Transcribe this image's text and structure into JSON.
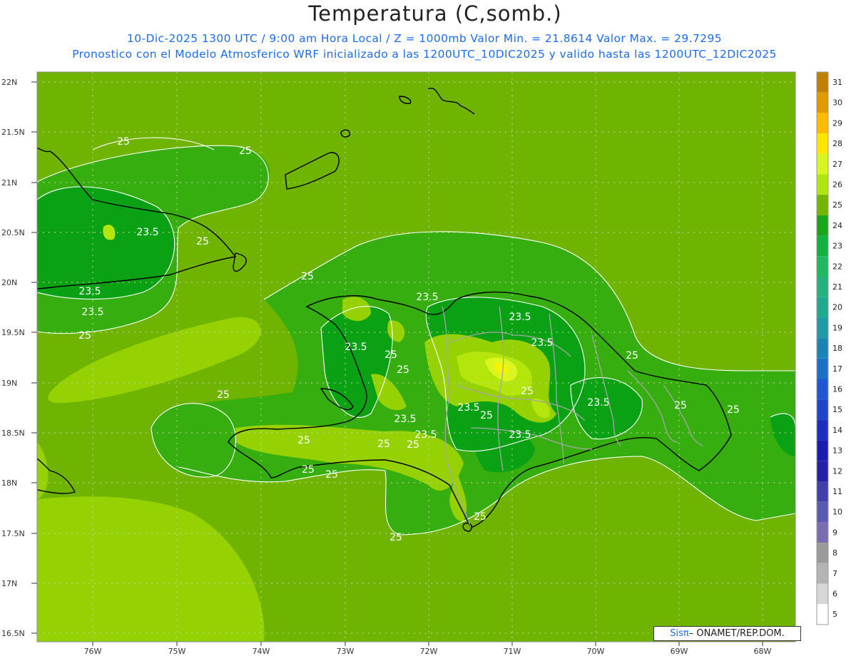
{
  "header": {
    "title": "Temperatura (C,somb.)",
    "subtitle_line1": "10-Dic-2025  1300 UTC / 9:00 am Hora Local / Z = 1000mb   Valor Min. = 21.8614  Valor Max. = 29.7295",
    "subtitle_line2": "Pronostico con el Modelo Atmosferico WRF inicializado a las 1200UTC_10DIC2025 y valido hasta las  1200UTC_12DIC2025"
  },
  "map": {
    "lat_labels": [
      "22N",
      "21.5N",
      "21N",
      "20.5N",
      "20N",
      "19.5N",
      "19N",
      "18.5N",
      "18N",
      "17.5N",
      "17N",
      "16.5N"
    ],
    "lon_labels": [
      "76W",
      "75W",
      "74W",
      "73W",
      "72W",
      "71W",
      "70W",
      "69W",
      "68W"
    ],
    "contour_labels": [
      "25",
      "25",
      "23.5",
      "25",
      "23.5",
      "23.5",
      "25",
      "25",
      "23.5",
      "23.5",
      "25",
      "25",
      "23.5",
      "25",
      "23.5",
      "25",
      "23.5",
      "25",
      "23.5",
      "25",
      "23.5",
      "25",
      "25",
      "25",
      "25",
      "25",
      "23.5",
      "23.5",
      "25",
      "25",
      "25",
      "25"
    ],
    "colors": {
      "t23": "#0aa214",
      "t24": "#37ae0f",
      "t25": "#6fb400",
      "t26": "#95d103",
      "t27": "#b4e60c",
      "t28": "#dcf51e",
      "t29": "#f5f500",
      "coast": "#000000",
      "borders": "#a6a6a6",
      "contour_line": "#ffffff"
    }
  },
  "colorbar": {
    "labels": [
      "31",
      "30",
      "29",
      "28",
      "27",
      "26",
      "25",
      "24",
      "23",
      "22",
      "21",
      "20",
      "19",
      "18",
      "17",
      "16",
      "15",
      "14",
      "13",
      "12",
      "11",
      "10",
      "9",
      "8",
      "7",
      "6",
      "5"
    ],
    "colors": [
      "#c08000",
      "#e09b00",
      "#ffbb00",
      "#ffe600",
      "#d7f51e",
      "#aee614",
      "#74b500",
      "#1ba51a",
      "#11b23e",
      "#20b860",
      "#25b080",
      "#20a890",
      "#1e9ba4",
      "#1a84b4",
      "#1b6fc4",
      "#1e58d0",
      "#1e44c8",
      "#1b2cc0",
      "#1a1cb0",
      "#2620a8",
      "#4040a8",
      "#5a5ab0",
      "#7c6cb0",
      "#9a9a9a",
      "#b4b4b4",
      "#d6d6d6",
      "#ffffff"
    ]
  },
  "credit": {
    "sis": "Sisπ",
    "rest": " – ONAMET/REP.DOM."
  }
}
